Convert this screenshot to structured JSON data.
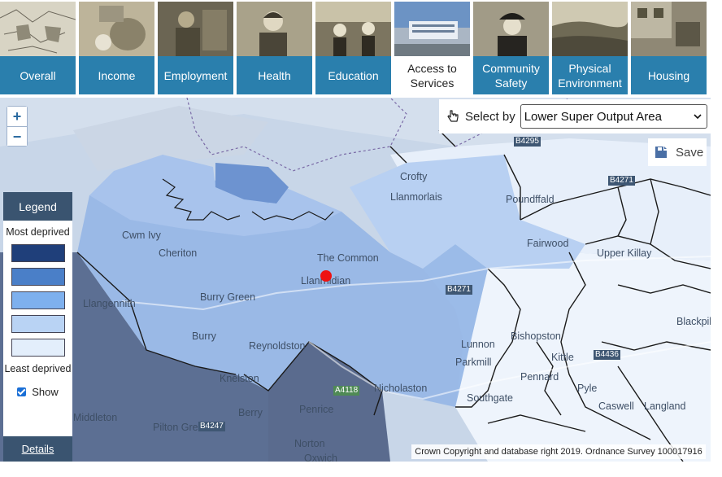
{
  "tabs": [
    {
      "label": "Overall",
      "active": false
    },
    {
      "label": "Income",
      "active": false
    },
    {
      "label": "Employment",
      "active": false
    },
    {
      "label": "Health",
      "active": false
    },
    {
      "label": "Education",
      "active": false
    },
    {
      "label": "Access to Services",
      "active": true
    },
    {
      "label": "Community Safety",
      "active": false
    },
    {
      "label": "Physical Environment",
      "active": false
    },
    {
      "label": "Housing",
      "active": false
    }
  ],
  "map": {
    "zoom_in": "+",
    "zoom_out": "−",
    "select_by": {
      "label": "Select by",
      "value": "Lower Super Output Area"
    },
    "save_label": "Save",
    "legend": {
      "title": "Legend",
      "most": "Most deprived",
      "least": "Least deprived",
      "colors": [
        "#1f3f7a",
        "#4a7fc8",
        "#7eb0ee",
        "#b9d3f4",
        "#e3eefb"
      ],
      "show_label": "Show",
      "show_checked": true
    },
    "details_label": "Details",
    "copyright": "Crown Copyright and database right 2019. Ordnance Survey 100017916",
    "places": [
      "Crofty",
      "Llanmorlais",
      "Poundffald",
      "Fairwood",
      "Upper Killay",
      "Cwm Ivy",
      "Cheriton",
      "The Common",
      "Llanrhidian",
      "Llangennith",
      "Burry Green",
      "Burry",
      "Reynoldston",
      "Knelston",
      "Berry",
      "Penrice",
      "Middleton",
      "Pilton Green",
      "Norton",
      "Oxwich",
      "Nicholaston",
      "Lunnon",
      "Parkmill",
      "Southgate",
      "Pennard",
      "Pyle",
      "Kittle",
      "Bishopston",
      "Langland",
      "Caswell",
      "Blackpill"
    ],
    "roads": [
      "B4295",
      "B4271",
      "B4436",
      "A4118",
      "B4247",
      "B4271"
    ]
  }
}
